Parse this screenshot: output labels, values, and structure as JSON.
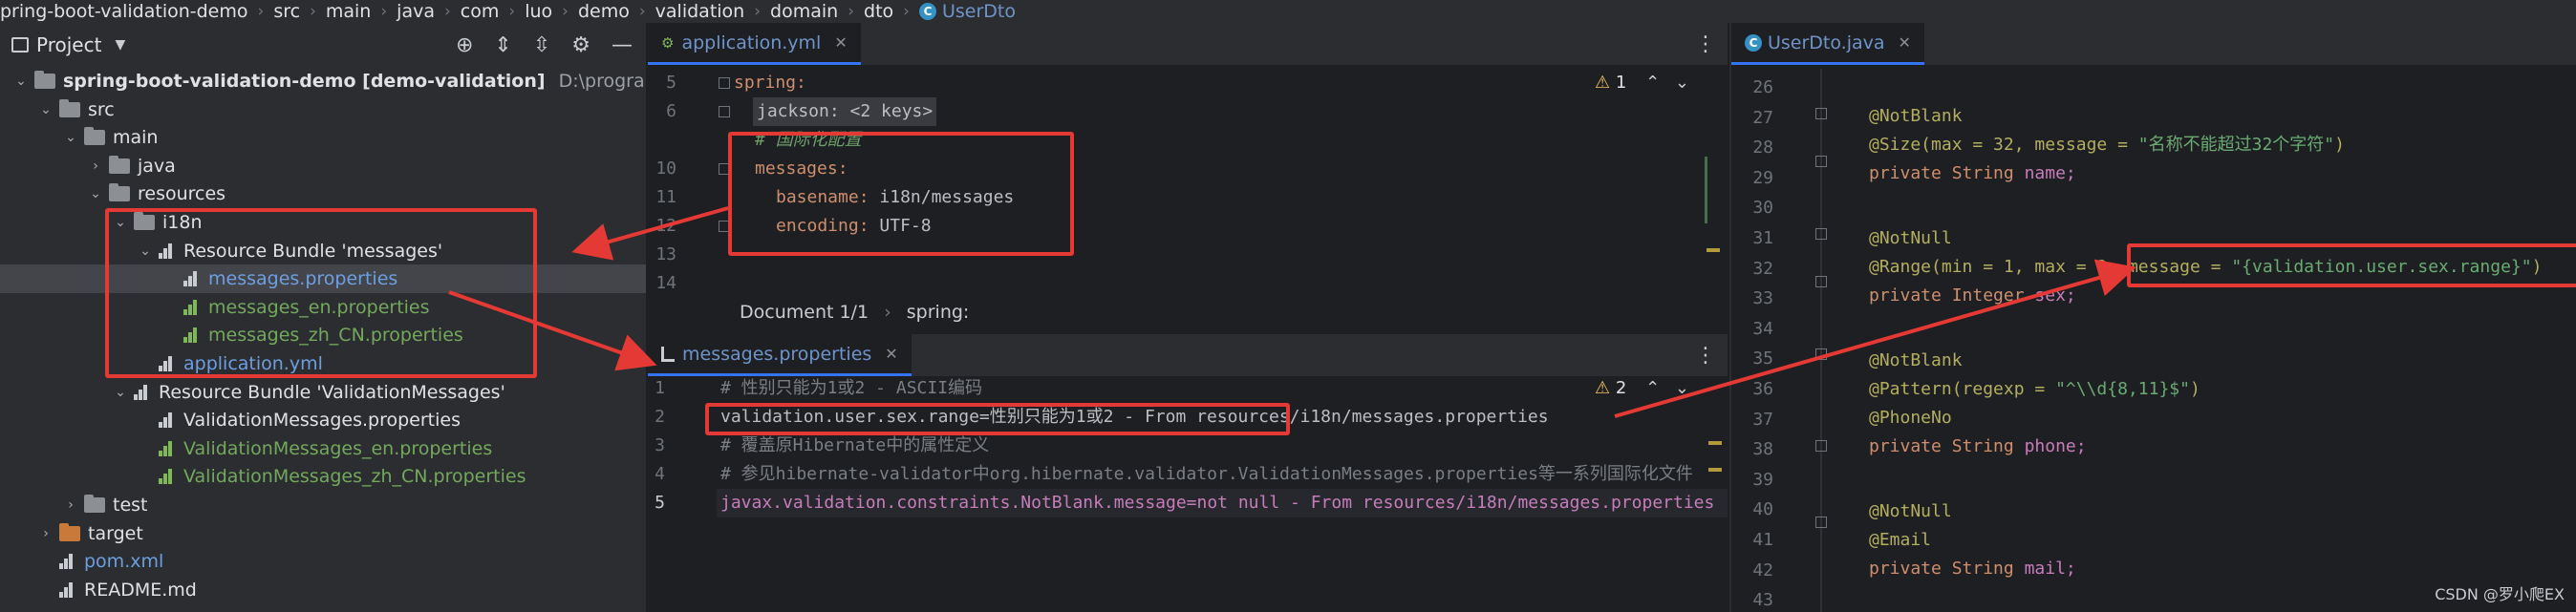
{
  "breadcrumb": [
    "pring-boot-validation-demo",
    "src",
    "main",
    "java",
    "com",
    "luo",
    "demo",
    "validation",
    "domain",
    "dto",
    "UserDto"
  ],
  "project": {
    "title": "Project",
    "tree": [
      {
        "label": "spring-boot-validation-demo [demo-validation]",
        "suffix": "D:\\progra",
        "indent": 0,
        "icon": "module-folder-icon",
        "chev": "open"
      },
      {
        "label": "src",
        "indent": 1,
        "icon": "folder-icon",
        "chev": "open"
      },
      {
        "label": "main",
        "indent": 2,
        "icon": "folder-icon",
        "chev": "open"
      },
      {
        "label": "java",
        "indent": 3,
        "icon": "folder-icon",
        "chev": "closed"
      },
      {
        "label": "resources",
        "indent": 3,
        "icon": "resources-folder-icon",
        "chev": "open"
      },
      {
        "label": "i18n",
        "indent": 4,
        "icon": "folder-icon",
        "chev": "open"
      },
      {
        "label": "Resource Bundle 'messages'",
        "indent": 5,
        "icon": "resource-bundle-icon",
        "chev": "open"
      },
      {
        "label": "messages.properties",
        "indent": 6,
        "icon": "properties-file-icon",
        "color": "blue",
        "selected": true
      },
      {
        "label": "messages_en.properties",
        "indent": 6,
        "icon": "properties-file-icon",
        "color": "green"
      },
      {
        "label": "messages_zh_CN.properties",
        "indent": 6,
        "icon": "properties-file-icon",
        "color": "green"
      },
      {
        "label": "application.yml",
        "indent": 5,
        "icon": "yaml-file-icon",
        "color": "blue"
      },
      {
        "label": "Resource Bundle 'ValidationMessages'",
        "indent": 4,
        "icon": "resource-bundle-icon",
        "chev": "open"
      },
      {
        "label": "ValidationMessages.properties",
        "indent": 5,
        "icon": "properties-file-icon"
      },
      {
        "label": "ValidationMessages_en.properties",
        "indent": 5,
        "icon": "properties-file-icon",
        "color": "green"
      },
      {
        "label": "ValidationMessages_zh_CN.properties",
        "indent": 5,
        "icon": "properties-file-icon",
        "color": "green"
      },
      {
        "label": "test",
        "indent": 2,
        "icon": "folder-icon",
        "chev": "closed"
      },
      {
        "label": "target",
        "indent": 1,
        "icon": "target-folder-icon",
        "chev": "closed"
      },
      {
        "label": "pom.xml",
        "indent": 1,
        "icon": "maven-file-icon",
        "color": "blue"
      },
      {
        "label": "README.md",
        "indent": 1,
        "icon": "markdown-file-icon"
      }
    ]
  },
  "yml_editor": {
    "tab": "application.yml",
    "warnings": "1",
    "lines": [
      "5",
      "6",
      "10",
      "11",
      "12",
      "13",
      "14"
    ],
    "code": {
      "l5": "spring:",
      "l6": "jackson: <2 keys>",
      "l_comment": "# 国际化配置",
      "l10": "messages:",
      "l11_key": "basename:",
      "l11_val": "i18n/messages",
      "l12_key": "encoding:",
      "l12_val": "UTF-8"
    },
    "status_doc": "Document 1/1",
    "status_path": "spring:"
  },
  "props_editor": {
    "tab": "messages.properties",
    "warnings": "2",
    "lines": [
      "1",
      "2",
      "3",
      "4",
      "5"
    ],
    "code": [
      "# 性别只能为1或2 - ASCII编码",
      "validation.user.sex.range=性别只能为1或2 - From resources/i18n/messages.properties",
      "# 覆盖原Hibernate中的属性定义",
      "# 参见hibernate-validator中org.hibernate.validator.ValidationMessages.properties等一系列国际化文件",
      "javax.validation.constraints.NotBlank.message=not null - From resources/i18n/messages.properties"
    ]
  },
  "java_editor": {
    "tab": "UserDto.java",
    "lines": [
      "26",
      "27",
      "28",
      "29",
      "30",
      "31",
      "32",
      "33",
      "34",
      "35",
      "36",
      "37",
      "38",
      "39",
      "40",
      "41",
      "42",
      "43"
    ],
    "code": {
      "l27": "@NotBlank",
      "l28_a": "@Size(max = 32, message = ",
      "l28_s": "\"名称不能超过32个字符\"",
      "l28_b": ")",
      "l29_a": "private String ",
      "l29_b": "name;",
      "l31": "@NotNull",
      "l32_a": "@Range(min = 1, max = 2, ",
      "l32_b": "message = ",
      "l32_s": "\"{validation.user.sex.range}\"",
      "l32_c": ")",
      "l33_a": "private Integer ",
      "l33_b": "sex;",
      "l35": "@NotBlank",
      "l36_a": "@Pattern(regexp = ",
      "l36_s": "\"^\\\\d{8,11}$\"",
      "l36_b": ")",
      "l37": "@PhoneNo",
      "l38_a": "private String ",
      "l38_b": "phone;",
      "l40": "@NotNull",
      "l41": "@Email",
      "l42_a": "private String ",
      "l42_b": "mail;"
    }
  },
  "watermark": "CSDN @罗小爬EX",
  "colors": {
    "annotation_red": "#e53935",
    "accent_blue": "#3574f0"
  }
}
